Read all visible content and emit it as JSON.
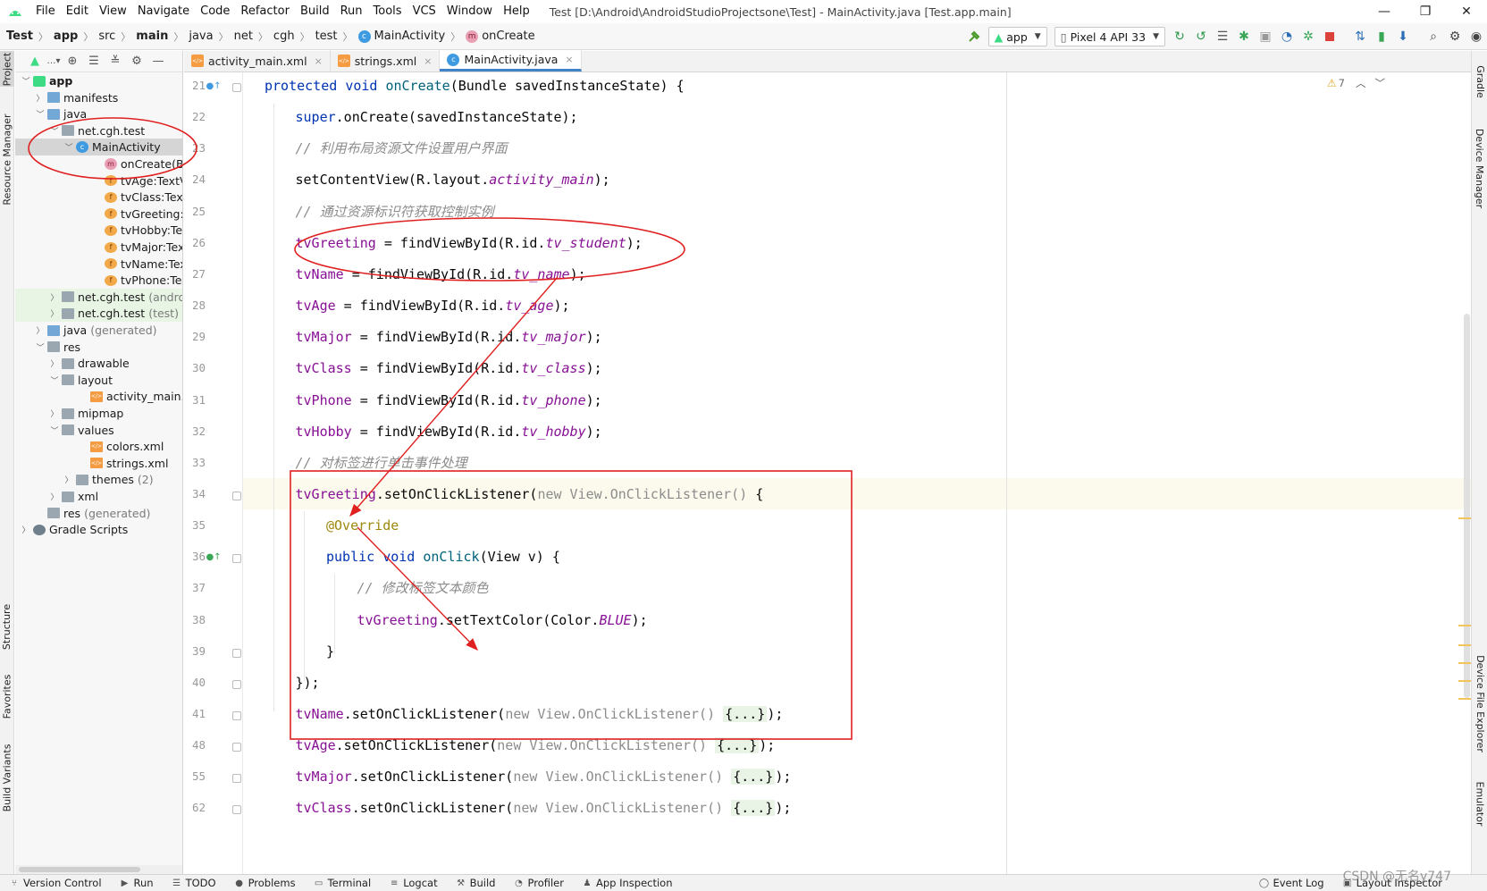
{
  "menubar": {
    "items": [
      "File",
      "Edit",
      "View",
      "Navigate",
      "Code",
      "Refactor",
      "Build",
      "Run",
      "Tools",
      "VCS",
      "Window",
      "Help"
    ],
    "title": "Test [D:\\Android\\AndroidStudioProjectsone\\Test] - MainActivity.java [Test.app.main]",
    "minimize": "—",
    "maximize": "❐",
    "close": "✕"
  },
  "navbar": {
    "crumbs": [
      "Test",
      "app",
      "src",
      "main",
      "java",
      "net",
      "cgh",
      "test",
      "MainActivity",
      "onCreate"
    ],
    "run_config": "app",
    "device": "Pixel 4 API 33"
  },
  "left_strip": {
    "project": "Project",
    "resource_manager": "Resource Manager",
    "structure": "Structure",
    "favorites": "Favorites",
    "build_variants": "Build Variants"
  },
  "right_strip": {
    "gradle": "Gradle",
    "device_manager": "Device Manager",
    "device_file_explorer": "Device File Explorer",
    "emulator": "Emulator"
  },
  "project_tree": [
    {
      "label": "app",
      "indent": 0,
      "chevron": "v",
      "icon": "app",
      "bold": true
    },
    {
      "label": "manifests",
      "indent": 1,
      "chevron": ">",
      "icon": "folder-blue"
    },
    {
      "label": "java",
      "indent": 1,
      "chevron": "v",
      "icon": "folder-blue"
    },
    {
      "label": "net.cgh.test",
      "indent": 2,
      "chevron": "v",
      "icon": "folder"
    },
    {
      "label": "MainActivity",
      "indent": 3,
      "chevron": "v",
      "icon": "class",
      "selected": true
    },
    {
      "label": "onCreate(Bun",
      "indent": 5,
      "chevron": "",
      "icon": "method"
    },
    {
      "label": "tvAge:TextVie",
      "indent": 5,
      "chevron": "",
      "icon": "field"
    },
    {
      "label": "tvClass:TextVi",
      "indent": 5,
      "chevron": "",
      "icon": "field"
    },
    {
      "label": "tvGreeting:Te",
      "indent": 5,
      "chevron": "",
      "icon": "field"
    },
    {
      "label": "tvHobby:Text",
      "indent": 5,
      "chevron": "",
      "icon": "field"
    },
    {
      "label": "tvMajor:TextV",
      "indent": 5,
      "chevron": "",
      "icon": "field"
    },
    {
      "label": "tvName:TextV",
      "indent": 5,
      "chevron": "",
      "icon": "field"
    },
    {
      "label": "tvPhone:TextV",
      "indent": 5,
      "chevron": "",
      "icon": "field"
    },
    {
      "label": "net.cgh.test",
      "muted": "(androi",
      "indent": 2,
      "chevron": ">",
      "icon": "folder",
      "greenish": true
    },
    {
      "label": "net.cgh.test",
      "muted": "(test)",
      "indent": 2,
      "chevron": ">",
      "icon": "folder",
      "greenish": true
    },
    {
      "label": "java",
      "muted": "(generated)",
      "indent": 1,
      "chevron": ">",
      "icon": "folder-blue"
    },
    {
      "label": "res",
      "indent": 1,
      "chevron": "v",
      "icon": "folder-res"
    },
    {
      "label": "drawable",
      "indent": 2,
      "chevron": ">",
      "icon": "folder"
    },
    {
      "label": "layout",
      "indent": 2,
      "chevron": "v",
      "icon": "folder"
    },
    {
      "label": "activity_main.xm",
      "indent": 4,
      "chevron": "",
      "icon": "xml"
    },
    {
      "label": "mipmap",
      "indent": 2,
      "chevron": ">",
      "icon": "folder"
    },
    {
      "label": "values",
      "indent": 2,
      "chevron": "v",
      "icon": "folder"
    },
    {
      "label": "colors.xml",
      "indent": 4,
      "chevron": "",
      "icon": "xml"
    },
    {
      "label": "strings.xml",
      "indent": 4,
      "chevron": "",
      "icon": "xml"
    },
    {
      "label": "themes",
      "muted": "(2)",
      "indent": 3,
      "chevron": ">",
      "icon": "folder"
    },
    {
      "label": "xml",
      "indent": 2,
      "chevron": ">",
      "icon": "folder"
    },
    {
      "label": "res",
      "muted": "(generated)",
      "indent": 1,
      "chevron": "",
      "icon": "folder-res"
    },
    {
      "label": "Gradle Scripts",
      "indent": 0,
      "chevron": ">",
      "icon": "gradle"
    }
  ],
  "editor_tabs": [
    {
      "label": "activity_main.xml",
      "icon": "xml",
      "active": false
    },
    {
      "label": "strings.xml",
      "icon": "xml",
      "active": false
    },
    {
      "label": "MainActivity.java",
      "icon": "class",
      "active": true
    }
  ],
  "inspection": {
    "warnings": "7"
  },
  "code_lines": [
    {
      "n": "21",
      "indent": 0,
      "tokens": [
        [
          "kw",
          "protected "
        ],
        [
          "kw",
          "void "
        ],
        [
          "fn",
          "onCreate"
        ],
        [
          "",
          "(Bundle savedInstanceState) {"
        ]
      ]
    },
    {
      "n": "22",
      "indent": 1,
      "tokens": [
        [
          "kw",
          "super"
        ],
        [
          "",
          ".onCreate(savedInstanceState);"
        ]
      ]
    },
    {
      "n": "23",
      "indent": 1,
      "tokens": [
        [
          "cm",
          "// 利用布局资源文件设置用户界面"
        ]
      ]
    },
    {
      "n": "24",
      "indent": 1,
      "tokens": [
        [
          "",
          "setContentView(R.layout."
        ],
        [
          "it",
          "activity_main"
        ],
        [
          "",
          ");"
        ]
      ]
    },
    {
      "n": "25",
      "indent": 1,
      "tokens": [
        [
          "cm",
          "// 通过资源标识符获取控制实例"
        ]
      ]
    },
    {
      "n": "26",
      "indent": 1,
      "tokens": [
        [
          "fld",
          "tvGreeting"
        ],
        [
          "",
          " = findViewById(R.id."
        ],
        [
          "it",
          "tv_student"
        ],
        [
          "",
          ");"
        ]
      ]
    },
    {
      "n": "27",
      "indent": 1,
      "tokens": [
        [
          "fld",
          "tvName"
        ],
        [
          "",
          " = findViewById(R.id."
        ],
        [
          "it",
          "tv_name"
        ],
        [
          "",
          ");"
        ]
      ]
    },
    {
      "n": "28",
      "indent": 1,
      "tokens": [
        [
          "fld",
          "tvAge"
        ],
        [
          "",
          " = findViewById(R.id."
        ],
        [
          "it",
          "tv_age"
        ],
        [
          "",
          ");"
        ]
      ]
    },
    {
      "n": "29",
      "indent": 1,
      "tokens": [
        [
          "fld",
          "tvMajor"
        ],
        [
          "",
          " = findViewById(R.id."
        ],
        [
          "it",
          "tv_major"
        ],
        [
          "",
          ");"
        ]
      ]
    },
    {
      "n": "30",
      "indent": 1,
      "tokens": [
        [
          "fld",
          "tvClass"
        ],
        [
          "",
          " = findViewById(R.id."
        ],
        [
          "it",
          "tv_class"
        ],
        [
          "",
          ");"
        ]
      ]
    },
    {
      "n": "31",
      "indent": 1,
      "tokens": [
        [
          "fld",
          "tvPhone"
        ],
        [
          "",
          " = findViewById(R.id."
        ],
        [
          "it",
          "tv_phone"
        ],
        [
          "",
          ");"
        ]
      ]
    },
    {
      "n": "32",
      "indent": 1,
      "tokens": [
        [
          "fld",
          "tvHobby"
        ],
        [
          "",
          " = findViewById(R.id."
        ],
        [
          "it",
          "tv_hobby"
        ],
        [
          "",
          ");"
        ]
      ]
    },
    {
      "n": "33",
      "indent": 1,
      "tokens": [
        [
          "cm",
          "// 对标签进行单击事件处理"
        ]
      ]
    },
    {
      "n": "34",
      "indent": 1,
      "tokens": [
        [
          "fld",
          "tvGreeting"
        ],
        [
          "",
          ".setOnClickListener("
        ],
        [
          "gr",
          "new View.OnClickListener() "
        ],
        [
          "",
          "{"
        ]
      ]
    },
    {
      "n": "35",
      "indent": 2,
      "tokens": [
        [
          "ann",
          "@Override"
        ]
      ]
    },
    {
      "n": "36",
      "indent": 2,
      "tokens": [
        [
          "kw",
          "public "
        ],
        [
          "kw",
          "void "
        ],
        [
          "fn",
          "onClick"
        ],
        [
          "",
          "(View v) {"
        ]
      ]
    },
    {
      "n": "37",
      "indent": 3,
      "tokens": [
        [
          "cm",
          "// 修改标签文本颜色"
        ]
      ]
    },
    {
      "n": "38",
      "indent": 3,
      "tokens": [
        [
          "fld",
          "tvGreeting"
        ],
        [
          "",
          ".setTextColor(Color."
        ],
        [
          "it",
          "BLUE"
        ],
        [
          "",
          ");"
        ]
      ]
    },
    {
      "n": "39",
      "indent": 2,
      "tokens": [
        [
          "",
          "}"
        ]
      ]
    },
    {
      "n": "40",
      "indent": 1,
      "tokens": [
        [
          "",
          "});"
        ]
      ]
    },
    {
      "n": "41",
      "indent": 1,
      "tokens": [
        [
          "fld",
          "tvName"
        ],
        [
          "",
          ".setOnClickListener("
        ],
        [
          "gr",
          "new View.OnClickListener() "
        ],
        [
          "fold",
          "{...}"
        ],
        [
          "",
          ");"
        ]
      ]
    },
    {
      "n": "48",
      "indent": 1,
      "tokens": [
        [
          "fld",
          "tvAge"
        ],
        [
          "",
          ".setOnClickListener("
        ],
        [
          "gr",
          "new View.OnClickListener() "
        ],
        [
          "fold",
          "{...}"
        ],
        [
          "",
          ");"
        ]
      ]
    },
    {
      "n": "55",
      "indent": 1,
      "tokens": [
        [
          "fld",
          "tvMajor"
        ],
        [
          "",
          ".setOnClickListener("
        ],
        [
          "gr",
          "new View.OnClickListener() "
        ],
        [
          "fold",
          "{...}"
        ],
        [
          "",
          ");"
        ]
      ]
    },
    {
      "n": "62",
      "indent": 1,
      "tokens": [
        [
          "fld",
          "tvClass"
        ],
        [
          "",
          ".setOnClickListener("
        ],
        [
          "gr",
          "new View.OnClickListener() "
        ],
        [
          "fold",
          "{...}"
        ],
        [
          "",
          ");"
        ]
      ]
    }
  ],
  "statusbar": {
    "items": [
      "Version Control",
      "Run",
      "TODO",
      "Problems",
      "Terminal",
      "Logcat",
      "Build",
      "Profiler",
      "App Inspection"
    ],
    "right_items": [
      "Event Log",
      "Layout Inspector"
    ]
  },
  "watermark": "CSDN @无名y747",
  "colors": {
    "annotation_red": "#e02020",
    "keyword": "#0033b3",
    "field": "#871094",
    "comment": "#8c8c8c",
    "annotation": "#9e880d"
  }
}
